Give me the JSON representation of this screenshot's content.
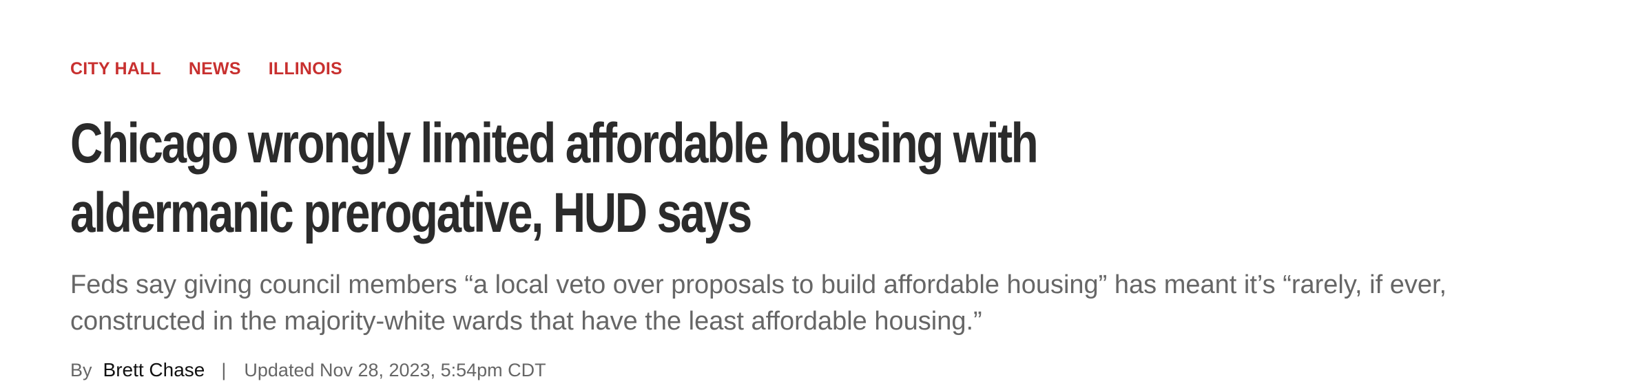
{
  "sections": [
    {
      "label": "CITY HALL"
    },
    {
      "label": "NEWS"
    },
    {
      "label": "ILLINOIS"
    }
  ],
  "headline": {
    "line1": "Chicago wrongly limited affordable housing with",
    "line2": "aldermanic prerogative, HUD says"
  },
  "dek": {
    "line1": "Feds say giving council members “a local veto over proposals to build affordable housing” has meant it’s “rarely, if ever,",
    "line2": "constructed in the majority-white wards that have the least affordable housing.”"
  },
  "byline": {
    "by_label": "By",
    "author": "Brett Chase",
    "separator": "|",
    "updated": "Updated Nov 28, 2023, 5:54pm CDT"
  },
  "colors": {
    "section_link": "#c8302f",
    "headline": "#2b2b2b",
    "dek": "#666666"
  }
}
